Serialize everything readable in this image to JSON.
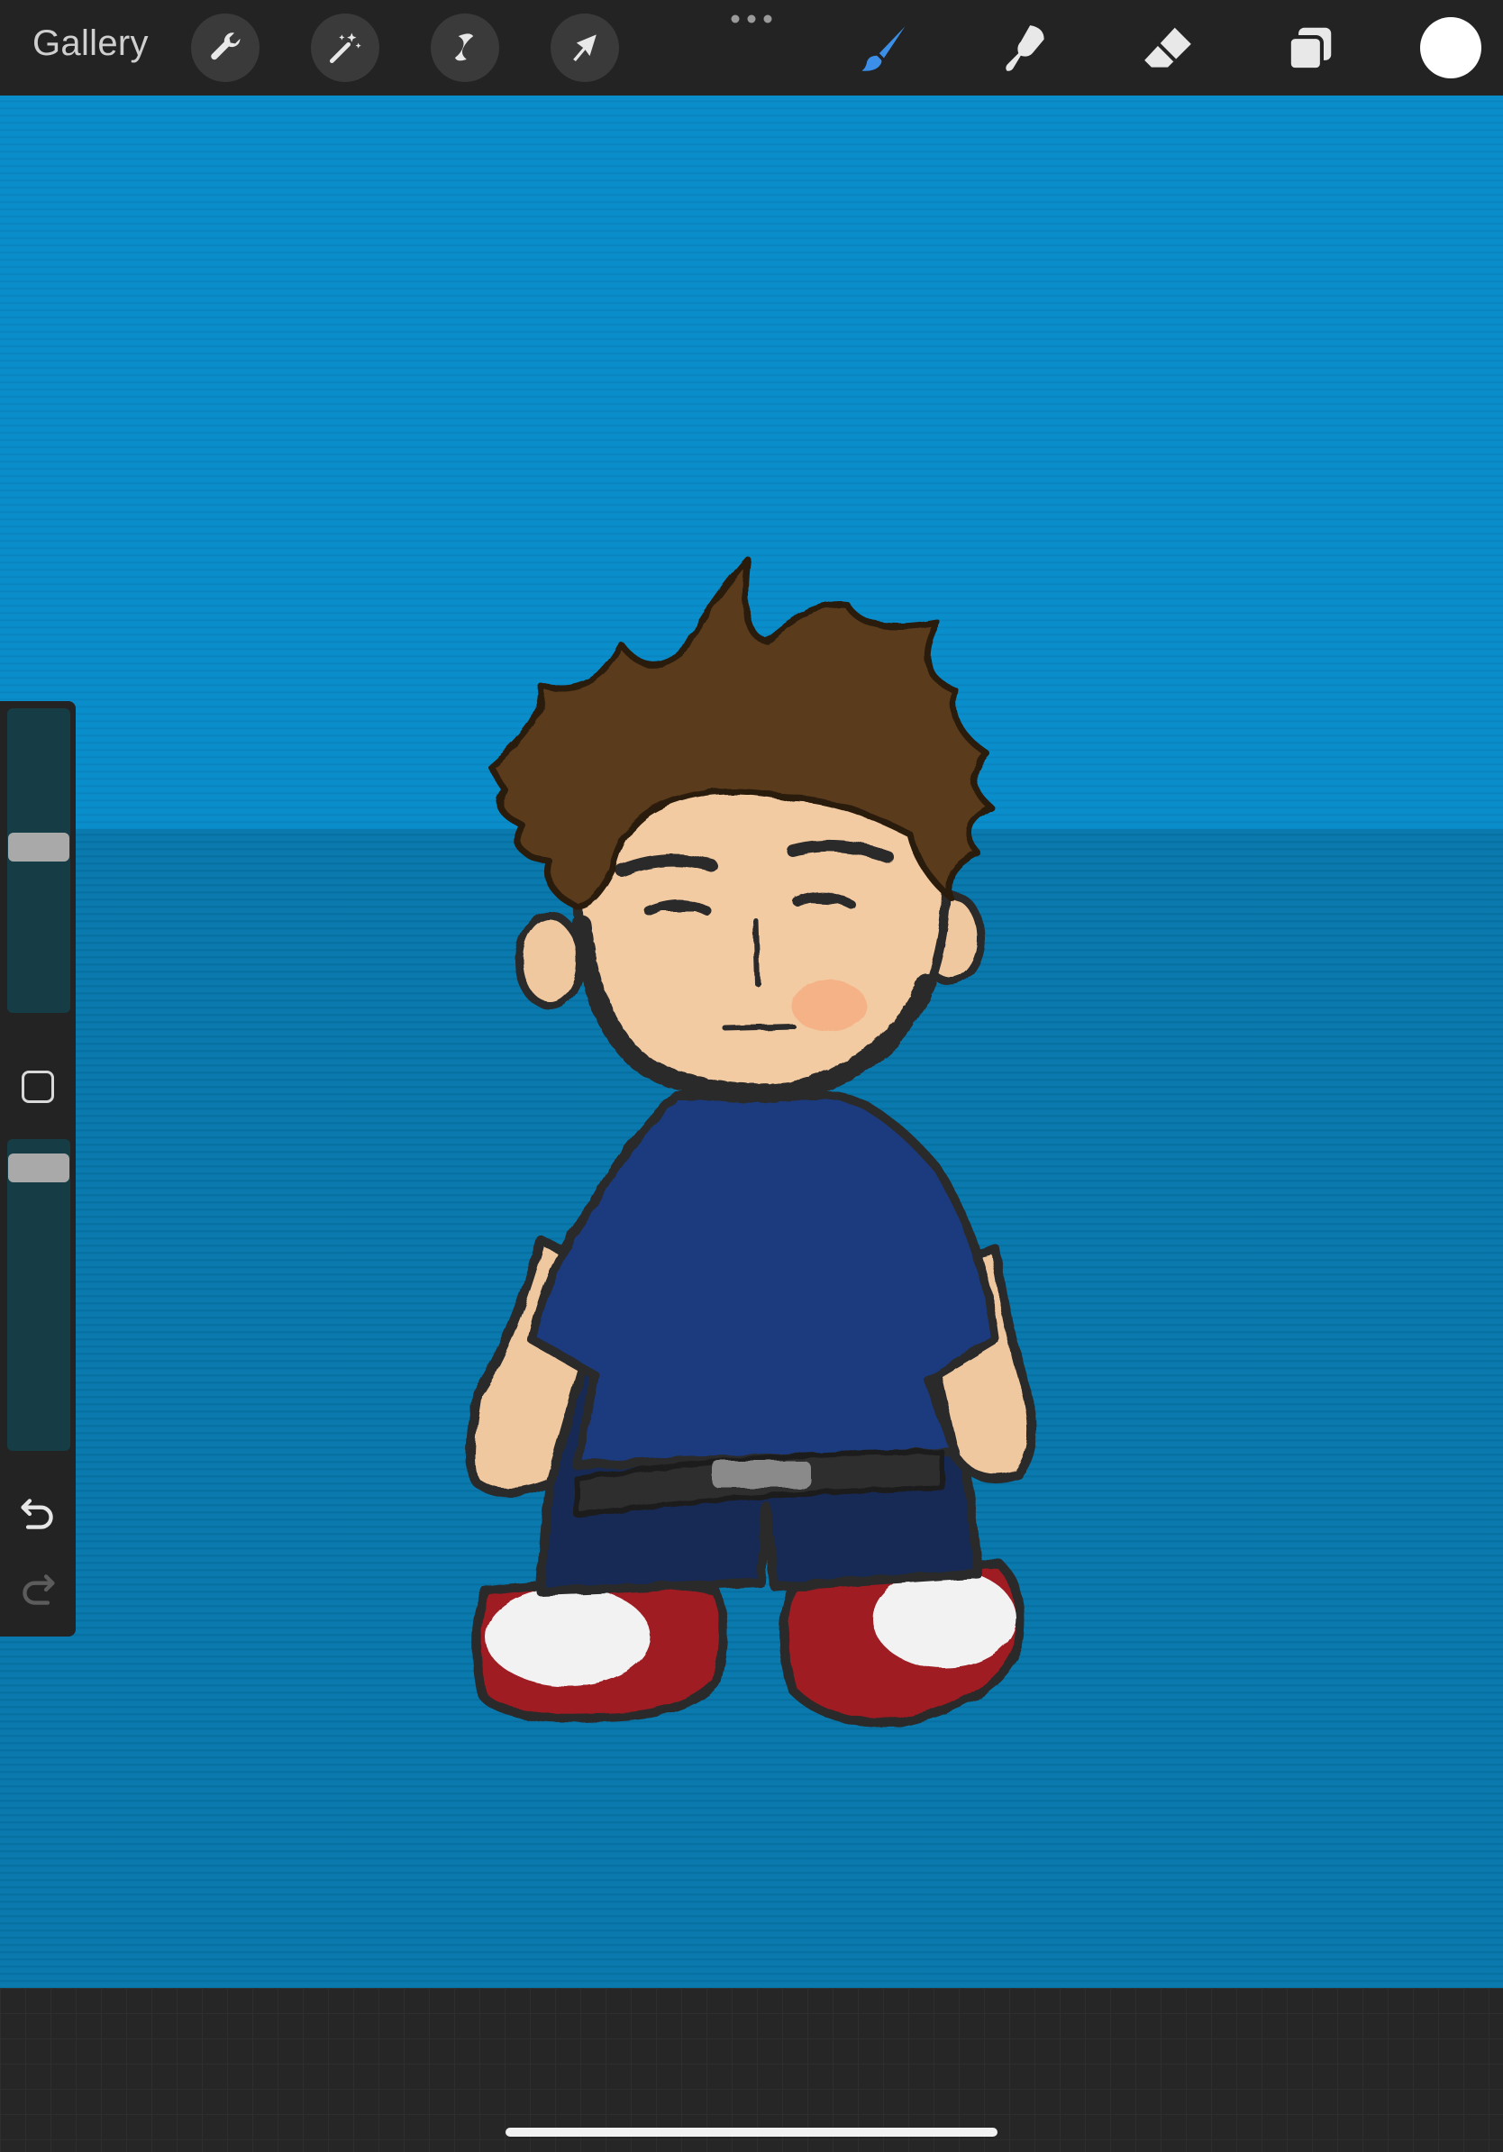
{
  "toolbar": {
    "gallery_label": "Gallery",
    "left_tools": [
      "wrench-icon",
      "magic-wand-icon",
      "selection-icon",
      "transform-arrow-icon"
    ],
    "right_tools": [
      "brush-icon",
      "smudge-icon",
      "eraser-icon",
      "layers-icon"
    ],
    "active_tool": "brush-icon",
    "current_color": "#ffffff",
    "accent_color": "#3b8fe8"
  },
  "sidebar": {
    "brush_size_level": 0.55,
    "opacity_level": 0.95,
    "controls": [
      "modify-square-icon",
      "undo-icon",
      "redo-icon"
    ]
  },
  "canvas": {
    "sky_color": "#0a8dcb",
    "ground_color": "#0979ae"
  }
}
